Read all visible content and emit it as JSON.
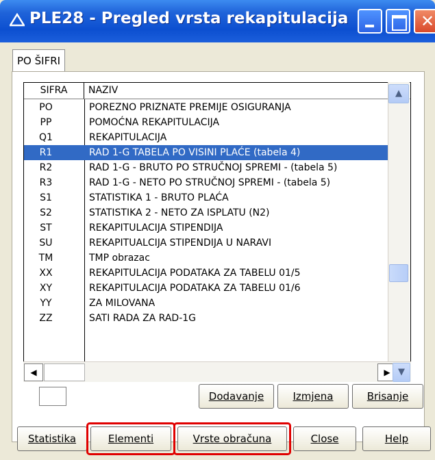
{
  "window": {
    "title": "PLE28 - Pregled vrsta rekapitulacija",
    "close_glyph": "✕"
  },
  "tabs": [
    {
      "label": "PO ŠIFRI"
    }
  ],
  "grid": {
    "columns": [
      "SIFRA",
      "NAZIV"
    ],
    "rows": [
      {
        "code": "PO",
        "name": "POREZNO PRIZNATE PREMIJE OSIGURANJA"
      },
      {
        "code": "PP",
        "name": "POMOĆNA REKAPITULACIJA"
      },
      {
        "code": "Q1",
        "name": "REKAPITULACIJA"
      },
      {
        "code": "R1",
        "name": "RAD 1-G TABELA PO VISINI PLAĆE (tabela 4)"
      },
      {
        "code": "R2",
        "name": "RAD 1-G - BRUTO PO STRUČNOJ SPREMI - (tabela 5)"
      },
      {
        "code": "R3",
        "name": "RAD 1-G - NETO PO STRUČNOJ SPREMI - (tabela 5)"
      },
      {
        "code": "S1",
        "name": "STATISTIKA 1 - BRUTO PLAĆA"
      },
      {
        "code": "S2",
        "name": "STATISTIKA 2 - NETO ZA ISPLATU (N2)"
      },
      {
        "code": "ST",
        "name": "REKAPITULACIJA STIPENDIJA"
      },
      {
        "code": "SU",
        "name": "REKAPITUALCIJA STIPENDIJA U NARAVI"
      },
      {
        "code": "TM",
        "name": "TMP obrazac"
      },
      {
        "code": "XX",
        "name": "REKAPITULACIJA PODATAKA ZA TABELU 01/5"
      },
      {
        "code": "XY",
        "name": "REKAPITULACIJA PODATAKA ZA TABELU 01/6"
      },
      {
        "code": "YY",
        "name": "ZA MILOVANA"
      },
      {
        "code": "ZZ",
        "name": "SATI RADA ZA RAD-1G"
      }
    ],
    "selected_code": "R1"
  },
  "record_buttons": {
    "add": "Dodavanje",
    "edit": "Izmjena",
    "delete": "Brisanje"
  },
  "bottom_buttons": {
    "statistics": "Statistika",
    "elements": "Elementi",
    "calc_types": "Vrste obračuna",
    "close": "Close",
    "help": "Help"
  },
  "highlight_color": "#e00000",
  "selection_color": "#316ac5",
  "titlebar_color": "#0c4fd0"
}
